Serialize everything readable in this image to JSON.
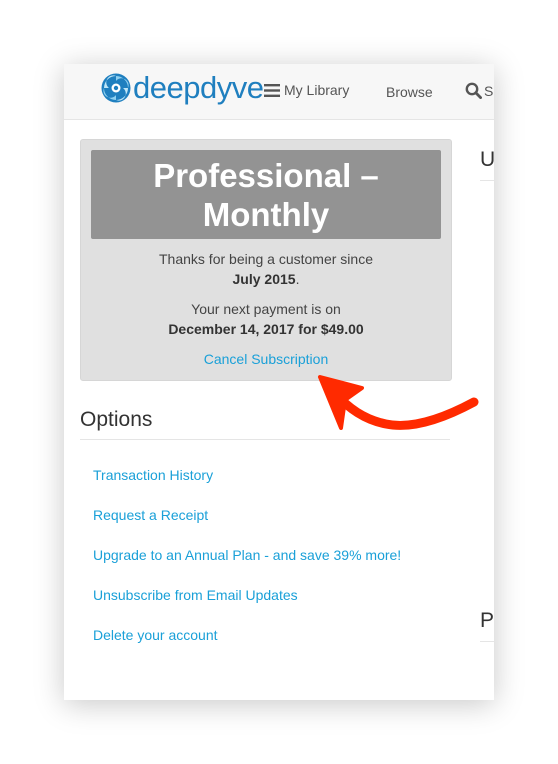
{
  "header": {
    "logo_text": "deepdyve",
    "nav": {
      "library_label": "My Library",
      "browse_label": "Browse",
      "search_label": "S"
    }
  },
  "plan": {
    "title_line1": "Professional –",
    "title_line2": "Monthly",
    "customer_since_prefix": "Thanks for being a customer since",
    "customer_since_date": "July 2015",
    "customer_since_suffix": ".",
    "next_payment_prefix": "Your next payment is on",
    "next_payment_detail": "December 14, 2017 for $49.00",
    "cancel_label": "Cancel Subscription"
  },
  "options": {
    "heading": "Options",
    "links": [
      "Transaction History",
      "Request a Receipt",
      "Upgrade to an Annual Plan - and save 39% more!",
      "Unsubscribe from Email Updates",
      "Delete your account"
    ]
  },
  "right_column": {
    "heading_top": "U",
    "heading_bottom": "P"
  },
  "colors": {
    "brand": "#1f7fbf",
    "link": "#1aa0d8",
    "plan_title_bg": "#939393",
    "card_bg": "#e0e0e0",
    "annotation_arrow": "#ff2a00"
  },
  "icons": {
    "logo": "deepdyve-swirl-icon",
    "library": "hamburger-icon",
    "search": "search-icon",
    "annotation": "red-arrow-icon"
  }
}
